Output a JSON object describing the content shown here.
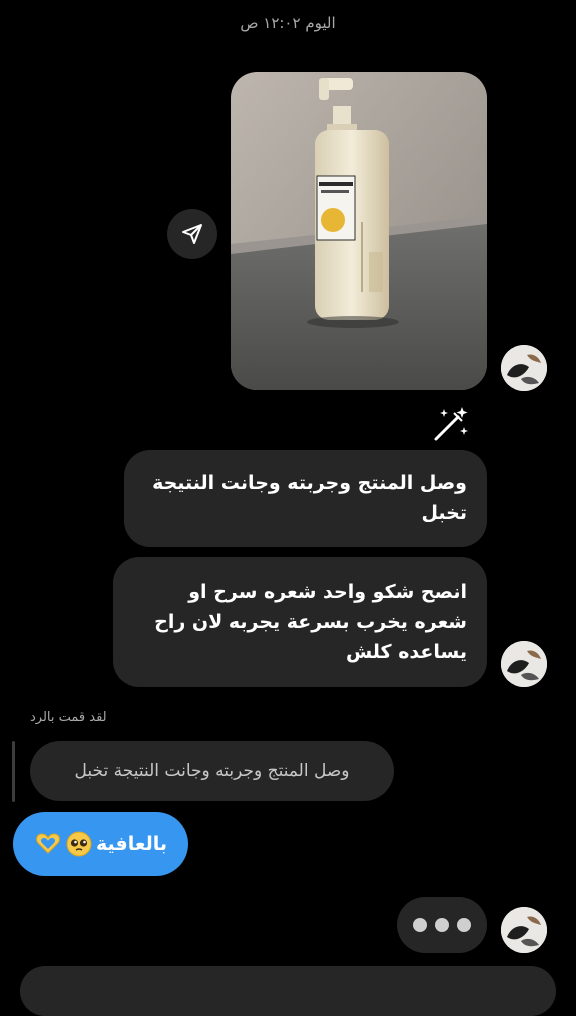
{
  "thread": {
    "timestamp": "اليوم ١٢:٠٢ ص",
    "received_1": "وصل المنتج وجربته وجانت النتيجة تخبل",
    "received_2": "انصح شكو واحد شعره سرح او شعره يخرب بسرعة يجربه لان راح يساعده كلش",
    "reply_label": "لقد قمت بالرد",
    "quoted_text": "وصل المنتج وجربته وجانت النتيجة تخبل",
    "sent_text": "بالعافية",
    "sent_emojis": [
      "pleading-face",
      "heart-hands"
    ]
  },
  "icons": {
    "share": "paper-plane-icon",
    "wand": "magic-wand-icon",
    "typing": "typing-indicator"
  },
  "colors": {
    "background": "#000000",
    "received_bubble": "#262626",
    "sent_bubble": "#3797f0",
    "timestamp_text": "#a8a8a8"
  }
}
